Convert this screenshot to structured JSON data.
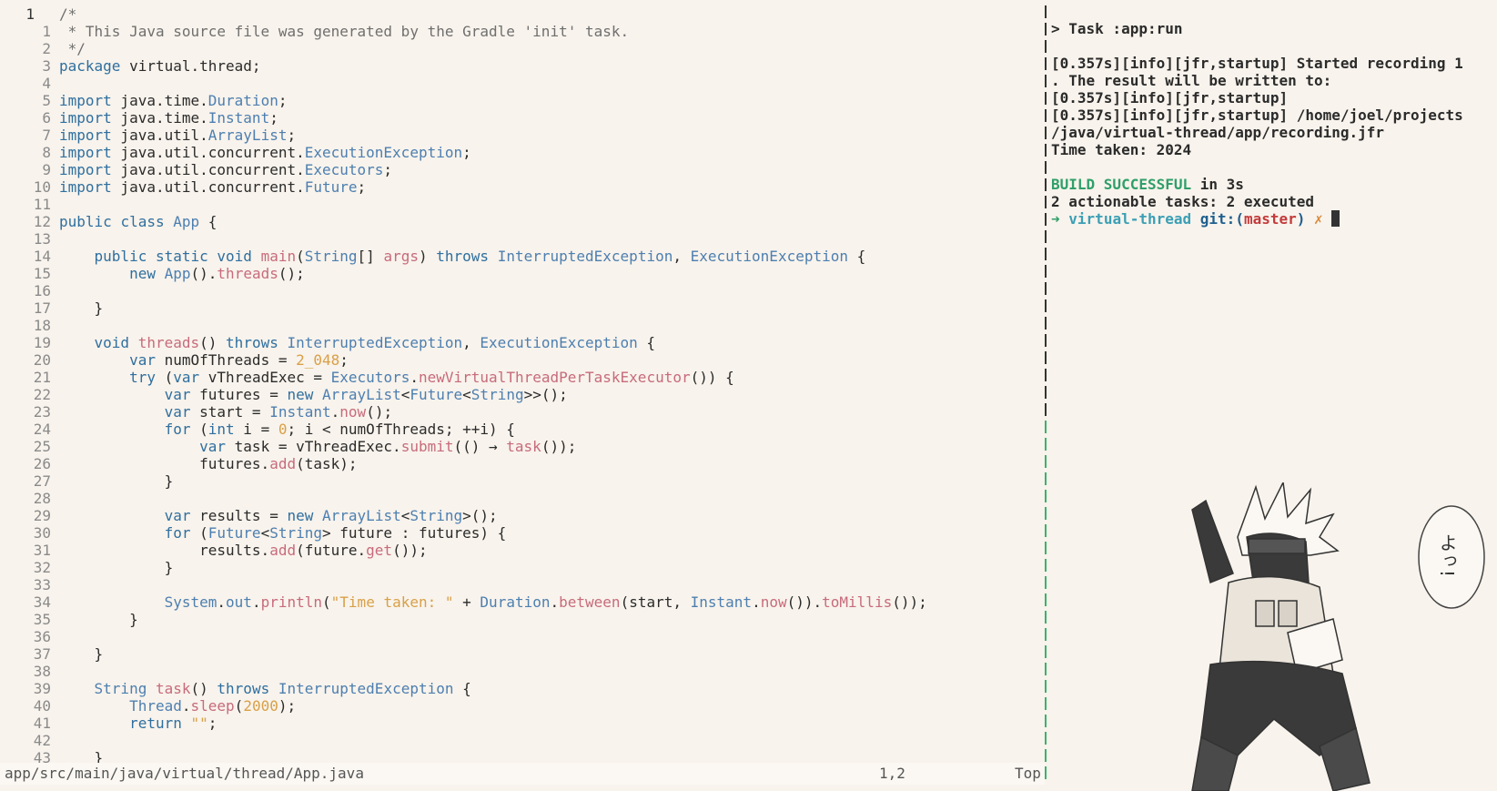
{
  "editor": {
    "current_line_number": "1",
    "lines": [
      {
        "n": "1",
        "code": "/*"
      },
      {
        "n": "1",
        "code": " * This Java source file was generated by the Gradle 'init' task."
      },
      {
        "n": "2",
        "code": " */"
      },
      {
        "n": "3",
        "code": "package virtual.thread;"
      },
      {
        "n": "4",
        "code": ""
      },
      {
        "n": "5",
        "code": "import java.time.Duration;"
      },
      {
        "n": "6",
        "code": "import java.time.Instant;"
      },
      {
        "n": "7",
        "code": "import java.util.ArrayList;"
      },
      {
        "n": "8",
        "code": "import java.util.concurrent.ExecutionException;"
      },
      {
        "n": "9",
        "code": "import java.util.concurrent.Executors;"
      },
      {
        "n": "10",
        "code": "import java.util.concurrent.Future;"
      },
      {
        "n": "11",
        "code": ""
      },
      {
        "n": "12",
        "code": "public class App {"
      },
      {
        "n": "13",
        "code": ""
      },
      {
        "n": "14",
        "code": "    public static void main(String[] args) throws InterruptedException, ExecutionException {"
      },
      {
        "n": "15",
        "code": "        new App().threads();"
      },
      {
        "n": "16",
        "code": ""
      },
      {
        "n": "17",
        "code": "    }"
      },
      {
        "n": "18",
        "code": ""
      },
      {
        "n": "19",
        "code": "    void threads() throws InterruptedException, ExecutionException {"
      },
      {
        "n": "20",
        "code": "        var numOfThreads = 2_048;"
      },
      {
        "n": "21",
        "code": "        try (var vThreadExec = Executors.newVirtualThreadPerTaskExecutor()) {"
      },
      {
        "n": "22",
        "code": "            var futures = new ArrayList<Future<String>>();"
      },
      {
        "n": "23",
        "code": "            var start = Instant.now();"
      },
      {
        "n": "24",
        "code": "            for (int i = 0; i < numOfThreads; ++i) {"
      },
      {
        "n": "25",
        "code": "                var task = vThreadExec.submit(() → task());"
      },
      {
        "n": "26",
        "code": "                futures.add(task);"
      },
      {
        "n": "27",
        "code": "            }"
      },
      {
        "n": "28",
        "code": ""
      },
      {
        "n": "29",
        "code": "            var results = new ArrayList<String>();"
      },
      {
        "n": "30",
        "code": "            for (Future<String> future : futures) {"
      },
      {
        "n": "31",
        "code": "                results.add(future.get());"
      },
      {
        "n": "32",
        "code": "            }"
      },
      {
        "n": "33",
        "code": ""
      },
      {
        "n": "34",
        "code": "            System.out.println(\"Time taken: \" + Duration.between(start, Instant.now()).toMillis());"
      },
      {
        "n": "35",
        "code": "        }"
      },
      {
        "n": "36",
        "code": ""
      },
      {
        "n": "37",
        "code": "    }"
      },
      {
        "n": "38",
        "code": ""
      },
      {
        "n": "39",
        "code": "    String task() throws InterruptedException {"
      },
      {
        "n": "40",
        "code": "        Thread.sleep(2000);"
      },
      {
        "n": "41",
        "code": "        return \"\";"
      },
      {
        "n": "42",
        "code": ""
      },
      {
        "n": "43",
        "code": "    }"
      }
    ]
  },
  "statusline": {
    "file_path": "app/src/main/java/virtual/thread/App.java",
    "cursor_position": "1,2",
    "scroll_position": "Top"
  },
  "terminal": {
    "lines": [
      "> Task :app:run",
      "",
      "[0.357s][info][jfr,startup] Started recording 1",
      ". The result will be written to:",
      "[0.357s][info][jfr,startup]",
      "[0.357s][info][jfr,startup] /home/joel/projects",
      "/java/virtual-thread/app/recording.jfr",
      "Time taken: 2024",
      ""
    ],
    "build_status": "BUILD SUCCESSFUL",
    "build_time": " in 3s",
    "actionable_tasks": "2 actionable tasks: 2 executed",
    "prompt_arrow": "➜",
    "prompt_dir": "virtual-thread",
    "prompt_git_label": "git:(",
    "prompt_branch": "master",
    "prompt_git_close": ")",
    "prompt_dirty": "✗"
  },
  "illustration": {
    "speech_text": "よっ!"
  },
  "colors": {
    "background": "#f8f3ec",
    "keyword": "#2f6f9f",
    "type": "#4d7fb0",
    "function": "#c76b7c",
    "number": "#d8a048",
    "split_divider": "#3bb26c",
    "build_success": "#2f9f6a"
  }
}
